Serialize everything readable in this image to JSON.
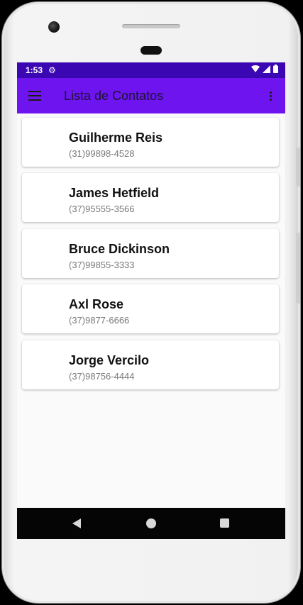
{
  "status_bar": {
    "time": "1:53",
    "settings_icon": "gear-icon",
    "indicators": [
      "wifi-icon",
      "signal-icon",
      "battery-icon"
    ]
  },
  "app_bar": {
    "menu_icon": "hamburger-menu-icon",
    "title": "Lista de Contatos",
    "overflow_icon": "more-vert-icon",
    "color": "#6e14ee"
  },
  "contacts": [
    {
      "name": "Guilherme Reis",
      "phone": "(31)99898-4528"
    },
    {
      "name": "James Hetfield",
      "phone": "(37)95555-3566"
    },
    {
      "name": "Bruce Dickinson",
      "phone": "(37)99855-3333"
    },
    {
      "name": "Axl Rose",
      "phone": "(37)9877-6666"
    },
    {
      "name": "Jorge Vercilo",
      "phone": "(37)98756-4444"
    }
  ],
  "nav_bar": {
    "buttons": [
      "back-icon",
      "home-icon",
      "recents-icon"
    ]
  }
}
